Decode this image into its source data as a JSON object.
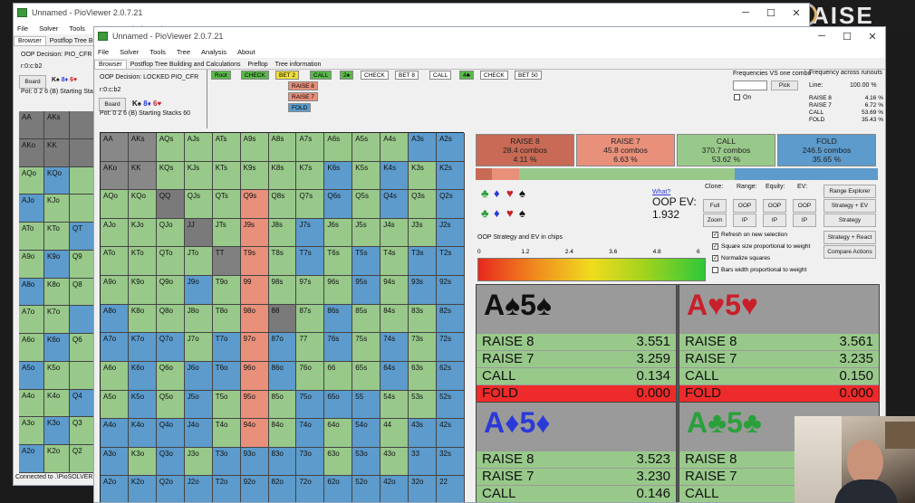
{
  "colors": {
    "raise8": "#c86a55",
    "raise7": "#e8907a",
    "call": "#98c98a",
    "fold": "#5c9bcc",
    "grey": "#888888",
    "darkgrey": "#6a6a6a",
    "accent": "#3c9a3c"
  },
  "back_window": {
    "title": "Unnamed - PioViewer 2.0.7.21",
    "menu": [
      "File",
      "Solver",
      "Tools",
      "Tree",
      "Analysis",
      "About"
    ],
    "tabs": [
      "Browser",
      "Postflop Tree Buildi"
    ],
    "oop_decision": "OOP Decision: PIO_CFR",
    "line": "r:0:c:b2",
    "board_label": "Board",
    "board_cards": [
      "K♠",
      "8♦",
      "6♥"
    ],
    "pot": "Pot: 0 2 6 (B) Starting Stacks",
    "status": "Connected to .\\PioSOLVER2-",
    "rows": [
      [
        "AA",
        "AKs",
        ""
      ],
      [
        "AKo",
        "KK",
        ""
      ],
      [
        "AQo",
        "KQo",
        ""
      ],
      [
        "AJo",
        "KJo",
        ""
      ],
      [
        "ATo",
        "KTo",
        "QT"
      ],
      [
        "A9o",
        "K9o",
        "Q9"
      ],
      [
        "A8o",
        "K8o",
        "Q8"
      ],
      [
        "A7o",
        "K7o",
        ""
      ],
      [
        "A6o",
        "K6o",
        "Q6"
      ],
      [
        "A5o",
        "K5o",
        ""
      ],
      [
        "A4o",
        "K4o",
        "Q4"
      ],
      [
        "A3o",
        "K3o",
        "Q3"
      ],
      [
        "A2o",
        "K2o",
        "Q2"
      ]
    ]
  },
  "main_window": {
    "title": "Unnamed - PioViewer 2.0.7.21",
    "menu": [
      "File",
      "Solver",
      "Tools",
      "Tree",
      "Analysis",
      "About"
    ],
    "tabs": [
      "Browser",
      "Postflop Tree Building and Calculations",
      "Preflop",
      "Tree information"
    ],
    "oop_decision": "OOP Decision: LOCKED PIO_CFR",
    "line": "r:0:c:b2",
    "board_label": "Board",
    "board_cards": [
      "K♠",
      "8♦",
      "6♥"
    ],
    "pot": "Pot: 0 2 6 (B) Starting Stacks 60",
    "tree_path": [
      "Root",
      "CHECK",
      "BET 2",
      "CALL",
      "2♠",
      "CHECK",
      "BET 8",
      "CALL",
      "4♣",
      "CHECK",
      "BET 50"
    ],
    "decision_options": [
      "RAISE 8",
      "RAISE 7",
      "FOLD"
    ]
  },
  "matrix": {
    "ranks": [
      "A",
      "K",
      "Q",
      "J",
      "T",
      "9",
      "8",
      "7",
      "6",
      "5",
      "4",
      "3",
      "2"
    ]
  },
  "actions": [
    {
      "name": "RAISE 8",
      "combos": "28.4 combos",
      "pct": "4.11 %",
      "freq": 4.11
    },
    {
      "name": "RAISE 7",
      "combos": "45.8 combos",
      "pct": "6.63 %",
      "freq": 6.63
    },
    {
      "name": "CALL",
      "combos": "370.7 combos",
      "pct": "53.62 %",
      "freq": 53.62
    },
    {
      "name": "FOLD",
      "combos": "246.5 combos",
      "pct": "35.65 %",
      "freq": 35.65
    }
  ],
  "right_panel": {
    "freq_vs_combo": "Frequencies VS one combo",
    "pick_label": "Pick",
    "on_label": "On",
    "freq_runouts": "Frequency across runouts",
    "line_label": "Line:",
    "line_value": "100.00 %",
    "runouts": [
      [
        "RAISE 8",
        "4.16 %"
      ],
      [
        "RAISE 7",
        "6.72 %"
      ],
      [
        "CALL",
        "53.69 %"
      ],
      [
        "FOLD",
        "35.43 %"
      ]
    ]
  },
  "controls": {
    "what_link": "What?",
    "oop_ev_label": "OOP EV:",
    "oop_ev_value": "1.932",
    "clone": "Clone:",
    "range": "Range:",
    "equity": "Equity:",
    "ev": "EV:",
    "full": "Full",
    "zoom": "Zoom",
    "oop": "OOP",
    "ip": "IP",
    "range_explorer": "Range Explorer",
    "strategy_ev": "Strategy + EV",
    "strategy": "Strategy",
    "strategy_react": "Strategy + React",
    "compare_actions": "Compare Actions",
    "legend_title": "OOP Strategy and EV in chips",
    "scale_ticks": [
      "0",
      "1.2",
      "2.4",
      "3.6",
      "4.8",
      "6"
    ],
    "checkboxes": [
      {
        "label": "Refresh on new selection",
        "checked": true
      },
      {
        "label": "Square size proportional to weight",
        "checked": true
      },
      {
        "label": "Normalize squares",
        "checked": true
      },
      {
        "label": "Bars width proportional to weight",
        "checked": false
      }
    ]
  },
  "combos": [
    {
      "rank1": "A",
      "suit1": "♠",
      "rank2": "5",
      "suit2": "♠",
      "color": "#111111",
      "rows": [
        [
          "RAISE 8",
          "3.551"
        ],
        [
          "RAISE 7",
          "3.259"
        ],
        [
          "CALL",
          "0.134"
        ],
        [
          "FOLD",
          "0.000"
        ]
      ]
    },
    {
      "rank1": "A",
      "suit1": "♥",
      "rank2": "5",
      "suit2": "♥",
      "color": "#c8202a",
      "rows": [
        [
          "RAISE 8",
          "3.561"
        ],
        [
          "RAISE 7",
          "3.235"
        ],
        [
          "CALL",
          "0.150"
        ],
        [
          "FOLD",
          "0.000"
        ]
      ]
    },
    {
      "rank1": "A",
      "suit1": "♦",
      "rank2": "5",
      "suit2": "♦",
      "color": "#2a3ad8",
      "rows": [
        [
          "RAISE 8",
          "3.523"
        ],
        [
          "RAISE 7",
          "3.230"
        ],
        [
          "CALL",
          "0.146"
        ]
      ]
    },
    {
      "rank1": "A",
      "suit1": "♣",
      "rank2": "5",
      "suit2": "♣",
      "color": "#2aa03a",
      "rows": [
        [
          "RAISE 8",
          ""
        ],
        [
          "RAISE 7",
          ""
        ],
        [
          "CALL",
          ""
        ]
      ]
    }
  ],
  "brand_text": "AISE"
}
